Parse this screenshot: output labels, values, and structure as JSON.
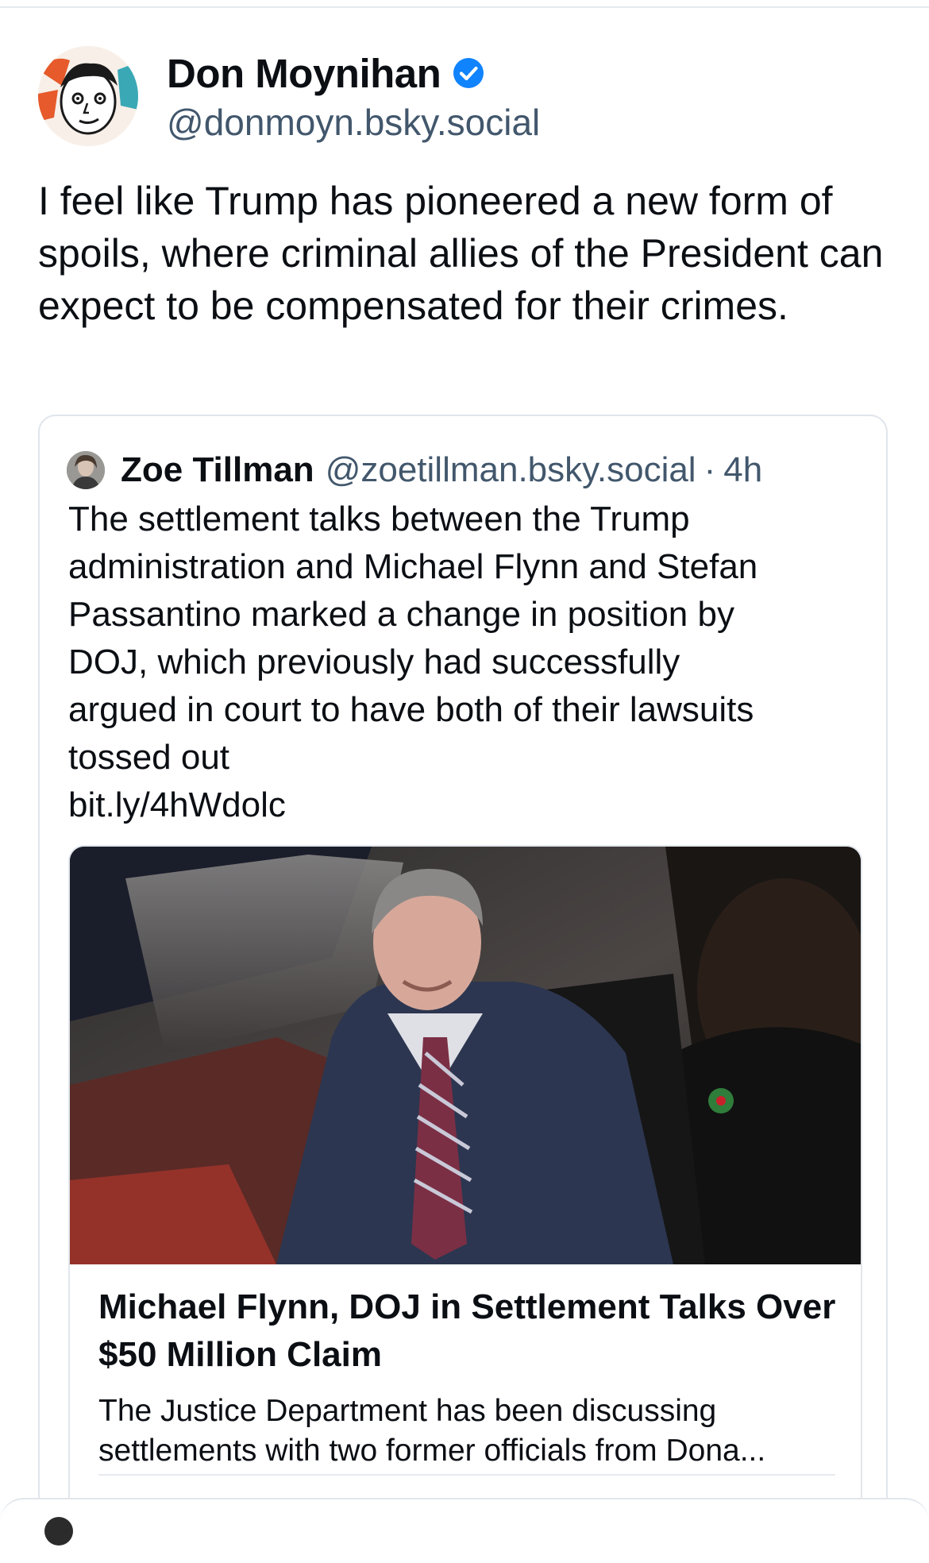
{
  "post": {
    "display_name": "Don Moynihan",
    "handle": "@donmoyn.bsky.social",
    "verified": true,
    "text": "I feel like Trump has pioneered a new form of spoils, where criminal allies of the President can expect to be compensated for their crimes."
  },
  "quote": {
    "display_name": "Zoe Tillman",
    "handle": "@zoetillman.bsky.social",
    "separator": "·",
    "time": "4h",
    "text_lines": [
      "The settlement talks between the Trump",
      "administration and Michael Flynn and Stefan",
      "Passantino marked a change in position by",
      "DOJ, which previously had successfully",
      "argued in court to have both of their lawsuits",
      "tossed out"
    ],
    "link": "bit.ly/4hWdolc",
    "embed": {
      "title": "Michael Flynn, DOJ in Settlement Talks Over $50 Million Claim",
      "description_lines": [
        "The Justice Department has been discussing",
        "settlements with two former officials from Dona..."
      ]
    }
  },
  "colors": {
    "text": "#0b0f14",
    "secondary": "#42576c",
    "verified": "#1083fe",
    "border": "#dfe5eb"
  },
  "icons": {
    "verified": "verified-check-icon"
  }
}
